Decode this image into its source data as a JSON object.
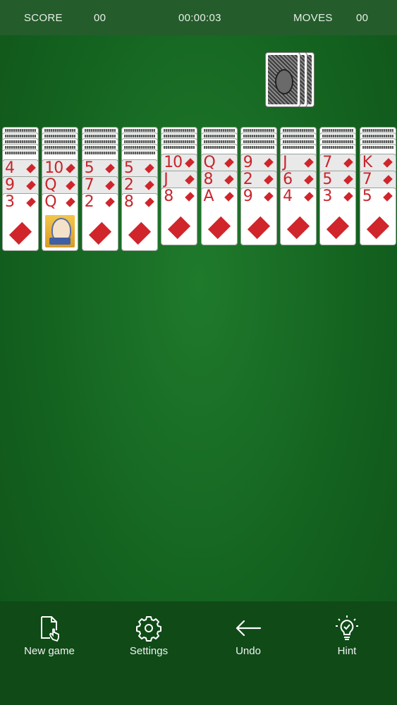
{
  "header": {
    "score_label": "SCORE",
    "score_value": "00",
    "timer": "00:00:03",
    "moves_label": "MOVES",
    "moves_value": "00"
  },
  "toolbar": {
    "new_game": "New game",
    "settings": "Settings",
    "undo": "Undo",
    "hint": "Hint"
  },
  "icons": [
    "new-game-icon",
    "gear-icon",
    "arrow-left-icon",
    "lightbulb-icon"
  ],
  "colors": {
    "felt": "#146320",
    "topbar": "#245c2b",
    "toolbar": "#0f4a17",
    "red_suit": "#c8252b"
  },
  "stock": {
    "remaining_piles": 3
  },
  "tableau": [
    {
      "face_down": 5,
      "face_up": [
        {
          "rank": "4",
          "suit": "diamonds"
        },
        {
          "rank": "9",
          "suit": "diamonds"
        },
        {
          "rank": "3",
          "suit": "diamonds"
        }
      ]
    },
    {
      "face_down": 5,
      "face_up": [
        {
          "rank": "10",
          "suit": "diamonds"
        },
        {
          "rank": "Q",
          "suit": "diamonds"
        },
        {
          "rank": "Q",
          "suit": "diamonds"
        }
      ]
    },
    {
      "face_down": 5,
      "face_up": [
        {
          "rank": "5",
          "suit": "diamonds"
        },
        {
          "rank": "7",
          "suit": "diamonds"
        },
        {
          "rank": "2",
          "suit": "diamonds"
        }
      ]
    },
    {
      "face_down": 5,
      "face_up": [
        {
          "rank": "5",
          "suit": "diamonds"
        },
        {
          "rank": "2",
          "suit": "diamonds"
        },
        {
          "rank": "8",
          "suit": "diamonds"
        }
      ]
    },
    {
      "face_down": 4,
      "face_up": [
        {
          "rank": "10",
          "suit": "diamonds"
        },
        {
          "rank": "J",
          "suit": "diamonds"
        },
        {
          "rank": "8",
          "suit": "diamonds"
        }
      ]
    },
    {
      "face_down": 4,
      "face_up": [
        {
          "rank": "Q",
          "suit": "diamonds"
        },
        {
          "rank": "8",
          "suit": "diamonds"
        },
        {
          "rank": "A",
          "suit": "diamonds"
        }
      ]
    },
    {
      "face_down": 4,
      "face_up": [
        {
          "rank": "9",
          "suit": "diamonds"
        },
        {
          "rank": "2",
          "suit": "diamonds"
        },
        {
          "rank": "9",
          "suit": "diamonds"
        }
      ]
    },
    {
      "face_down": 4,
      "face_up": [
        {
          "rank": "J",
          "suit": "diamonds"
        },
        {
          "rank": "6",
          "suit": "diamonds"
        },
        {
          "rank": "4",
          "suit": "diamonds"
        }
      ]
    },
    {
      "face_down": 4,
      "face_up": [
        {
          "rank": "7",
          "suit": "diamonds"
        },
        {
          "rank": "5",
          "suit": "diamonds"
        },
        {
          "rank": "3",
          "suit": "diamonds"
        }
      ]
    },
    {
      "face_down": 4,
      "face_up": [
        {
          "rank": "K",
          "suit": "diamonds"
        },
        {
          "rank": "7",
          "suit": "diamonds"
        },
        {
          "rank": "5",
          "suit": "diamonds"
        }
      ]
    }
  ]
}
